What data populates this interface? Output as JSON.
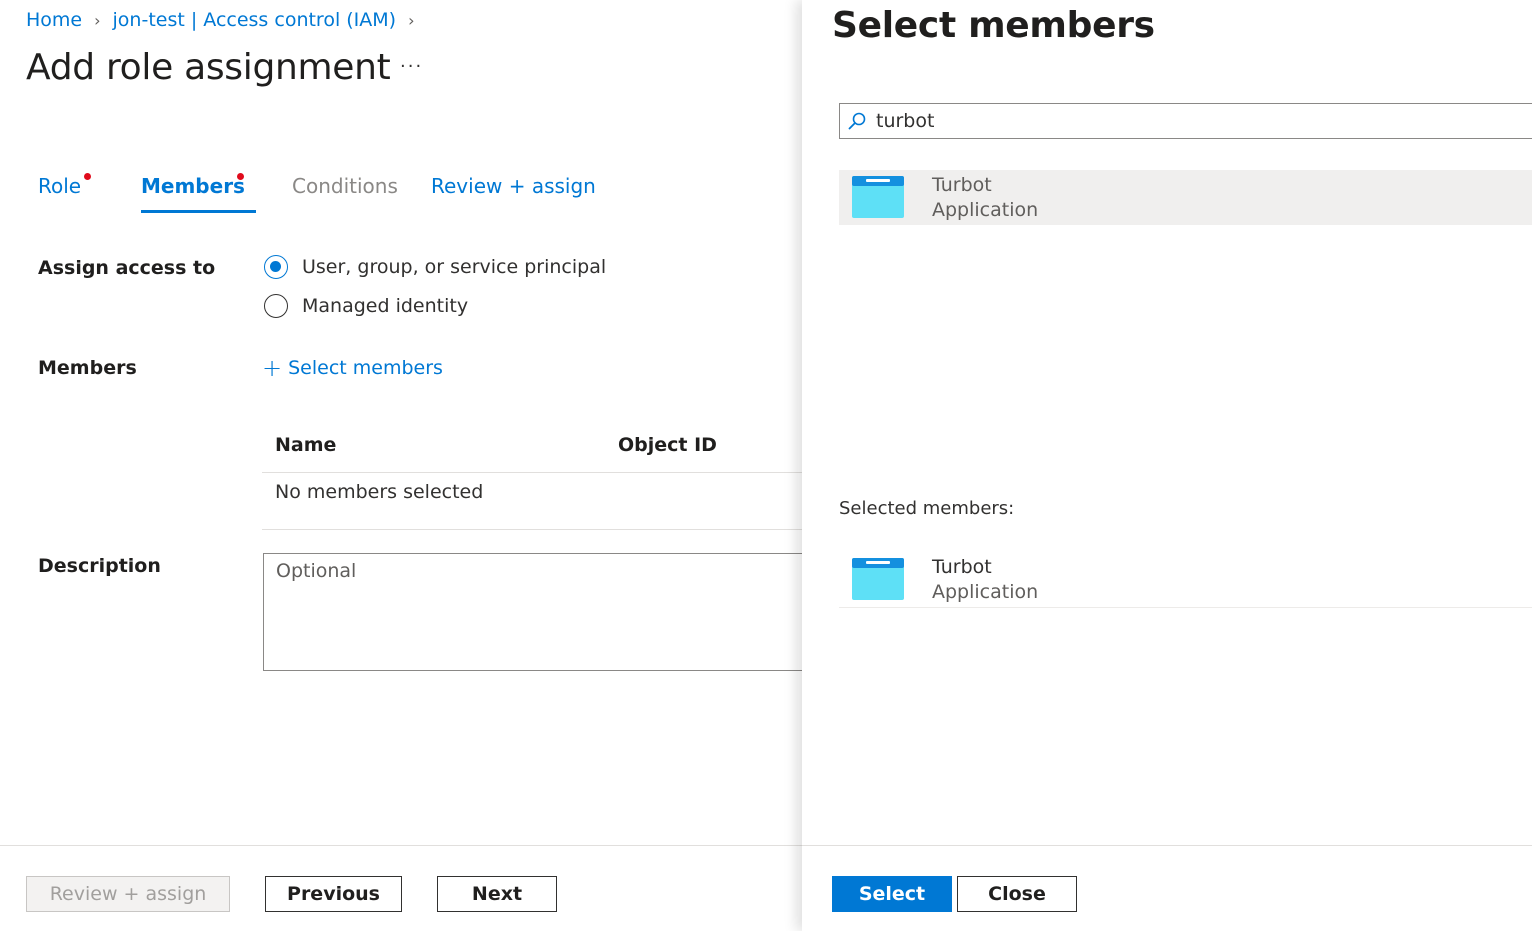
{
  "breadcrumb": {
    "items": [
      "Home",
      "jon-test | Access control (IAM)"
    ],
    "separator": ">"
  },
  "page": {
    "title": "Add role assignment",
    "more": "···"
  },
  "tabs": [
    {
      "label": "Role",
      "state": "enabled",
      "required": true
    },
    {
      "label": "Members",
      "state": "active",
      "required": true
    },
    {
      "label": "Conditions",
      "state": "disabled",
      "required": false
    },
    {
      "label": "Review + assign",
      "state": "enabled",
      "required": false
    }
  ],
  "form": {
    "assign_access_label": "Assign access to",
    "options": [
      {
        "label": "User, group, or service principal",
        "checked": true
      },
      {
        "label": "Managed identity",
        "checked": false
      }
    ],
    "members_label": "Members",
    "select_members_link": "Select members",
    "table": {
      "columns": [
        "Name",
        "Object ID"
      ],
      "empty_text": "No members selected"
    },
    "description_label": "Description",
    "description_placeholder": "Optional"
  },
  "footer": {
    "review_assign": "Review + assign",
    "previous": "Previous",
    "next": "Next"
  },
  "panel": {
    "title": "Select members",
    "search_value": "turbot",
    "results": [
      {
        "name": "Turbot",
        "type": "Application"
      }
    ],
    "selected_label": "Selected members:",
    "selected": [
      {
        "name": "Turbot",
        "type": "Application"
      }
    ],
    "select_button": "Select",
    "close_button": "Close"
  },
  "colors": {
    "accent": "#0078d4",
    "required_dot": "#e00b1c",
    "app_icon_light": "#5ee0f6",
    "app_icon_dark": "#1490df"
  }
}
